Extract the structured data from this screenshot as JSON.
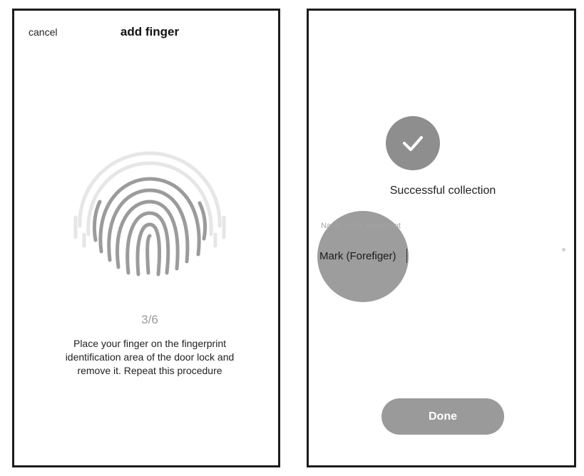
{
  "add_finger_screen": {
    "cancel_label": "cancel",
    "title": "add finger",
    "progress": "3/6",
    "instruction": "Place your finger on the fingerprint identification area of the door lock and remove it. Repeat this procedure"
  },
  "success_screen": {
    "status_text": "Successful collection",
    "name_field": {
      "label": "Name of the fingerprint",
      "value": "Mark (Forefiger)"
    },
    "done_label": "Done"
  },
  "icons": {
    "fingerprint": "fingerprint-icon",
    "check": "check-icon"
  },
  "colors": {
    "fingerprint_dark": "#9b9b9b",
    "fingerprint_light": "#e6e6e6",
    "check_circle": "#8e8e8e",
    "done_button": "#9a9a9a",
    "touch_indicator": "#9d9d9d"
  }
}
